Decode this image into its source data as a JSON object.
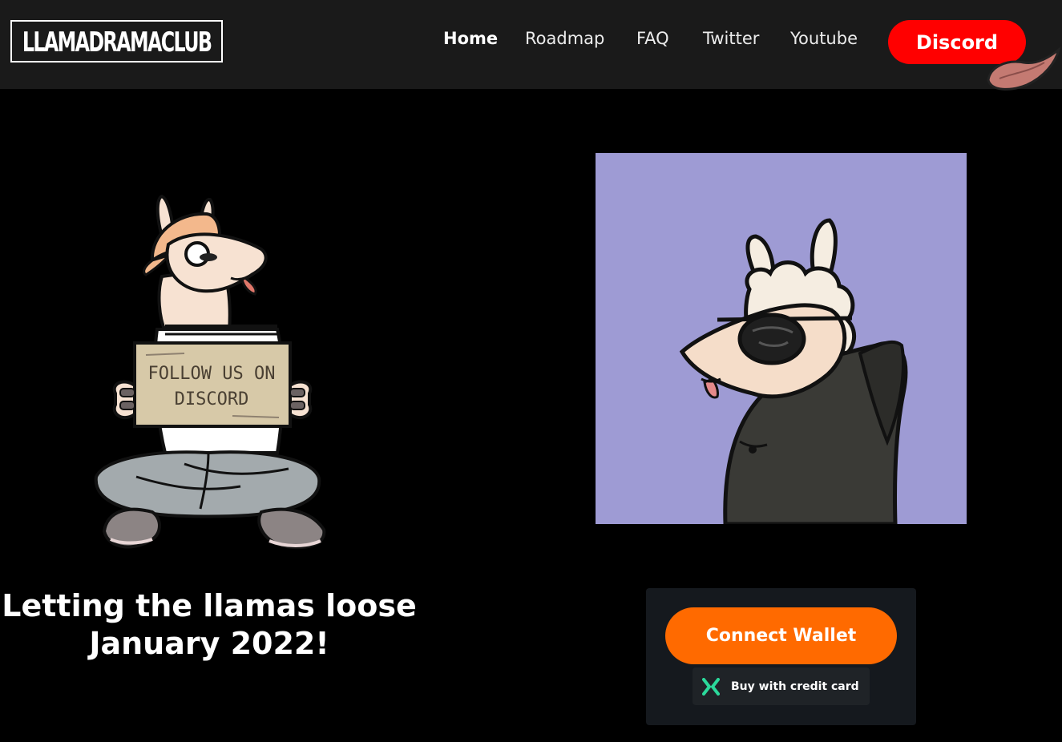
{
  "nav": {
    "logo": "LLAMADRAMACLUB",
    "links": [
      "Home",
      "Roadmap",
      "FAQ",
      "Twitter",
      "Youtube"
    ],
    "discord": "Discord"
  },
  "hero": {
    "sign_text": [
      "FOLLOW US ON",
      "DISCORD"
    ],
    "tagline_line1": "Letting the llamas loose",
    "tagline_line2": "January 2022!"
  },
  "mint": {
    "connect": "Connect Wallet",
    "credit": "Buy with credit card"
  },
  "colors": {
    "nav_bg": "#1a1a1a",
    "discord": "#ff0000",
    "connect": "#ff6a00",
    "card_bg": "#9e9bd4",
    "panel_bg": "#15191e"
  }
}
